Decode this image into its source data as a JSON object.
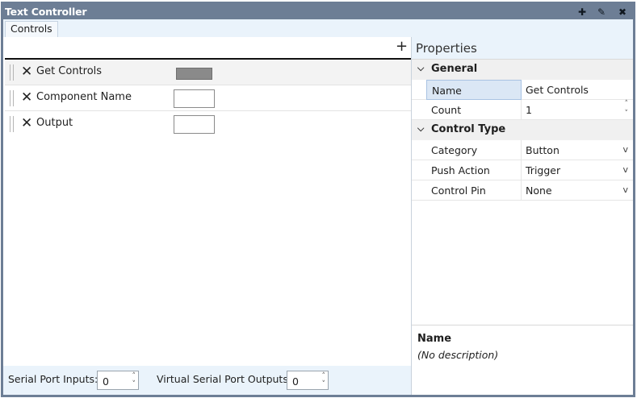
{
  "window": {
    "title": "Text Controller",
    "title_buttons": [
      "add-icon",
      "edit-pencil-icon",
      "close-icon"
    ]
  },
  "tabs": [
    "Controls"
  ],
  "controls_panel": {
    "add_symbol": "+",
    "items": [
      {
        "remove_glyph": "✕",
        "label": "Get Controls",
        "control": "button"
      },
      {
        "remove_glyph": "✕",
        "label": "Component Name",
        "control": "text"
      },
      {
        "remove_glyph": "✕",
        "label": "Output",
        "control": "text"
      }
    ]
  },
  "footer": {
    "serial_inputs_label": "Serial Port Inputs:",
    "serial_inputs_value": "0",
    "virtual_outputs_label": "Virtual Serial Port Outputs:",
    "virtual_outputs_value": "0"
  },
  "properties": {
    "title": "Properties",
    "categories": [
      {
        "label": "General",
        "props": [
          {
            "name": "Name",
            "value": "Get Controls"
          },
          {
            "name": "Count",
            "value": "1"
          }
        ]
      },
      {
        "label": "Control Type",
        "props": [
          {
            "name": "Category",
            "value": "Button"
          },
          {
            "name": "Push Action",
            "value": "Trigger"
          },
          {
            "name": "Control Pin",
            "value": "None"
          }
        ]
      }
    ],
    "description": {
      "title": "Name",
      "text": "(No description)"
    }
  },
  "glyphs": {
    "plus": "✚",
    "pencil": "✎",
    "close": "✖",
    "chevron_down": "⌵",
    "caret_down": "v",
    "spin_up": "˄",
    "spin_down": "˅"
  },
  "colors": {
    "titlebar": "#6d7e95",
    "panel_bg": "#eaf3fb",
    "selection": "#dbe7f5"
  }
}
